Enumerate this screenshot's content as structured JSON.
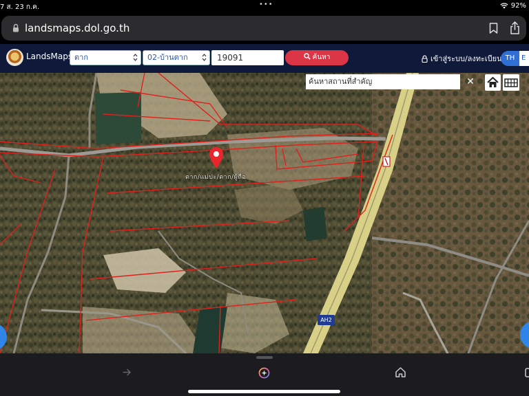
{
  "status_bar": {
    "left_text": "7  ส. 23 ก.ค.",
    "dots": "•••",
    "battery": "92%",
    "icons": [
      "wifi-icon"
    ]
  },
  "browser": {
    "url": "landsmaps.dol.go.th",
    "icons": [
      "lock-icon",
      "bookmark-icon",
      "share-icon"
    ],
    "toolbar_icons": [
      "forward-icon",
      "assistant-icon",
      "home-icon"
    ]
  },
  "header": {
    "app_name": "LandsMaps",
    "province": "ตาก",
    "district": "02-บ้านตาก",
    "parcel_number": "19091",
    "search_label": "ค้นหา",
    "login_label": "เข้าสู่ระบบ/ลงทะเบียน",
    "lang_th": "TH",
    "lang_en": "E"
  },
  "map": {
    "place_search_placeholder": "ค้นหาสถานที่สำคัญ",
    "clear_label": "✕",
    "parcel_label": "ตาก/แม่ปะ/ตาก/ผู้ถือ",
    "road_label": "AH2",
    "icons": [
      "map-pin-icon",
      "home-icon",
      "grid-icon"
    ],
    "colors": {
      "parcel_boundary": "#e0201c",
      "pin": "#e8262c",
      "highway": "#d9d088"
    }
  }
}
